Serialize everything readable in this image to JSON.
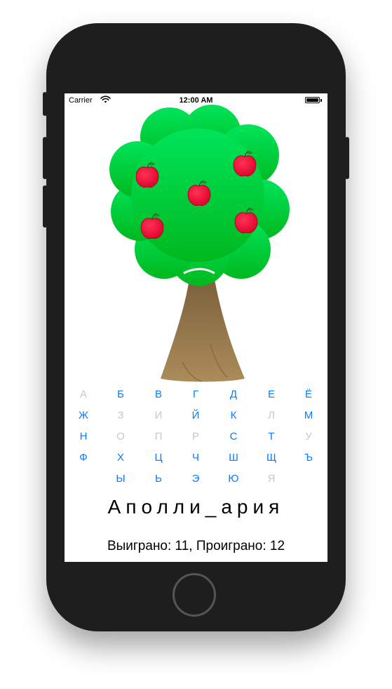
{
  "status_bar": {
    "carrier": "Carrier",
    "time": "12:00 AM"
  },
  "tree": {
    "apples": 5
  },
  "keyboard": {
    "rows": [
      [
        {
          "letter": "А",
          "enabled": false
        },
        {
          "letter": "Б",
          "enabled": true
        },
        {
          "letter": "В",
          "enabled": true
        },
        {
          "letter": "Г",
          "enabled": true
        },
        {
          "letter": "Д",
          "enabled": true
        },
        {
          "letter": "Е",
          "enabled": true
        },
        {
          "letter": "Ё",
          "enabled": true
        }
      ],
      [
        {
          "letter": "Ж",
          "enabled": true
        },
        {
          "letter": "З",
          "enabled": false
        },
        {
          "letter": "И",
          "enabled": false
        },
        {
          "letter": "Й",
          "enabled": true
        },
        {
          "letter": "К",
          "enabled": true
        },
        {
          "letter": "Л",
          "enabled": false
        },
        {
          "letter": "М",
          "enabled": true
        }
      ],
      [
        {
          "letter": "Н",
          "enabled": true
        },
        {
          "letter": "О",
          "enabled": false
        },
        {
          "letter": "П",
          "enabled": false
        },
        {
          "letter": "Р",
          "enabled": false
        },
        {
          "letter": "С",
          "enabled": true
        },
        {
          "letter": "Т",
          "enabled": true
        },
        {
          "letter": "У",
          "enabled": false
        }
      ],
      [
        {
          "letter": "Ф",
          "enabled": true
        },
        {
          "letter": "Х",
          "enabled": true
        },
        {
          "letter": "Ц",
          "enabled": true
        },
        {
          "letter": "Ч",
          "enabled": true
        },
        {
          "letter": "Ш",
          "enabled": true
        },
        {
          "letter": "Щ",
          "enabled": true
        },
        {
          "letter": "Ъ",
          "enabled": true
        }
      ],
      [
        {
          "letter": "",
          "enabled": false,
          "empty": true
        },
        {
          "letter": "Ы",
          "enabled": true
        },
        {
          "letter": "Ь",
          "enabled": true
        },
        {
          "letter": "Э",
          "enabled": true
        },
        {
          "letter": "Ю",
          "enabled": true
        },
        {
          "letter": "Я",
          "enabled": false
        },
        {
          "letter": "",
          "enabled": false,
          "empty": true
        }
      ]
    ]
  },
  "game": {
    "word": "Аполли_ария",
    "score": "Выиграно: 11, Проиграно: 12"
  },
  "colors": {
    "enabled_key": "#0a7aff",
    "disabled_key": "#c7c7cc",
    "foliage": "#00cc33",
    "trunk": "#9a7a4e",
    "apple": "#ff0033"
  }
}
